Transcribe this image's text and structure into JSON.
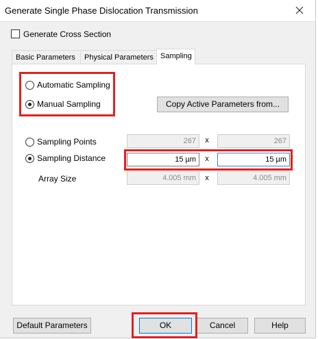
{
  "window": {
    "title": "Generate Single Phase Dislocation Transmission"
  },
  "options": {
    "cross_section_label": "Generate Cross Section",
    "cross_section_checked": false
  },
  "tabs": [
    {
      "label": "Basic Parameters"
    },
    {
      "label": "Physical Parameters"
    },
    {
      "label": "Sampling"
    }
  ],
  "sampling": {
    "automatic_label": "Automatic Sampling",
    "manual_label": "Manual Sampling",
    "copy_button": "Copy Active Parameters from...",
    "points_label": "Sampling Points",
    "distance_label": "Sampling Distance",
    "array_label": "Array Size",
    "points_x": "267",
    "points_y": "267",
    "distance_x": "15 µm",
    "distance_y": "15 µm",
    "array_x": "4.005 mm",
    "array_y": "4.005 mm",
    "x_sep": "x"
  },
  "footer": {
    "default_button": "Default Parameters",
    "ok_button": "OK",
    "cancel_button": "Cancel",
    "help_button": "Help"
  },
  "colors": {
    "highlight": "#e02020",
    "dialog_bg": "#f0f0f0"
  }
}
